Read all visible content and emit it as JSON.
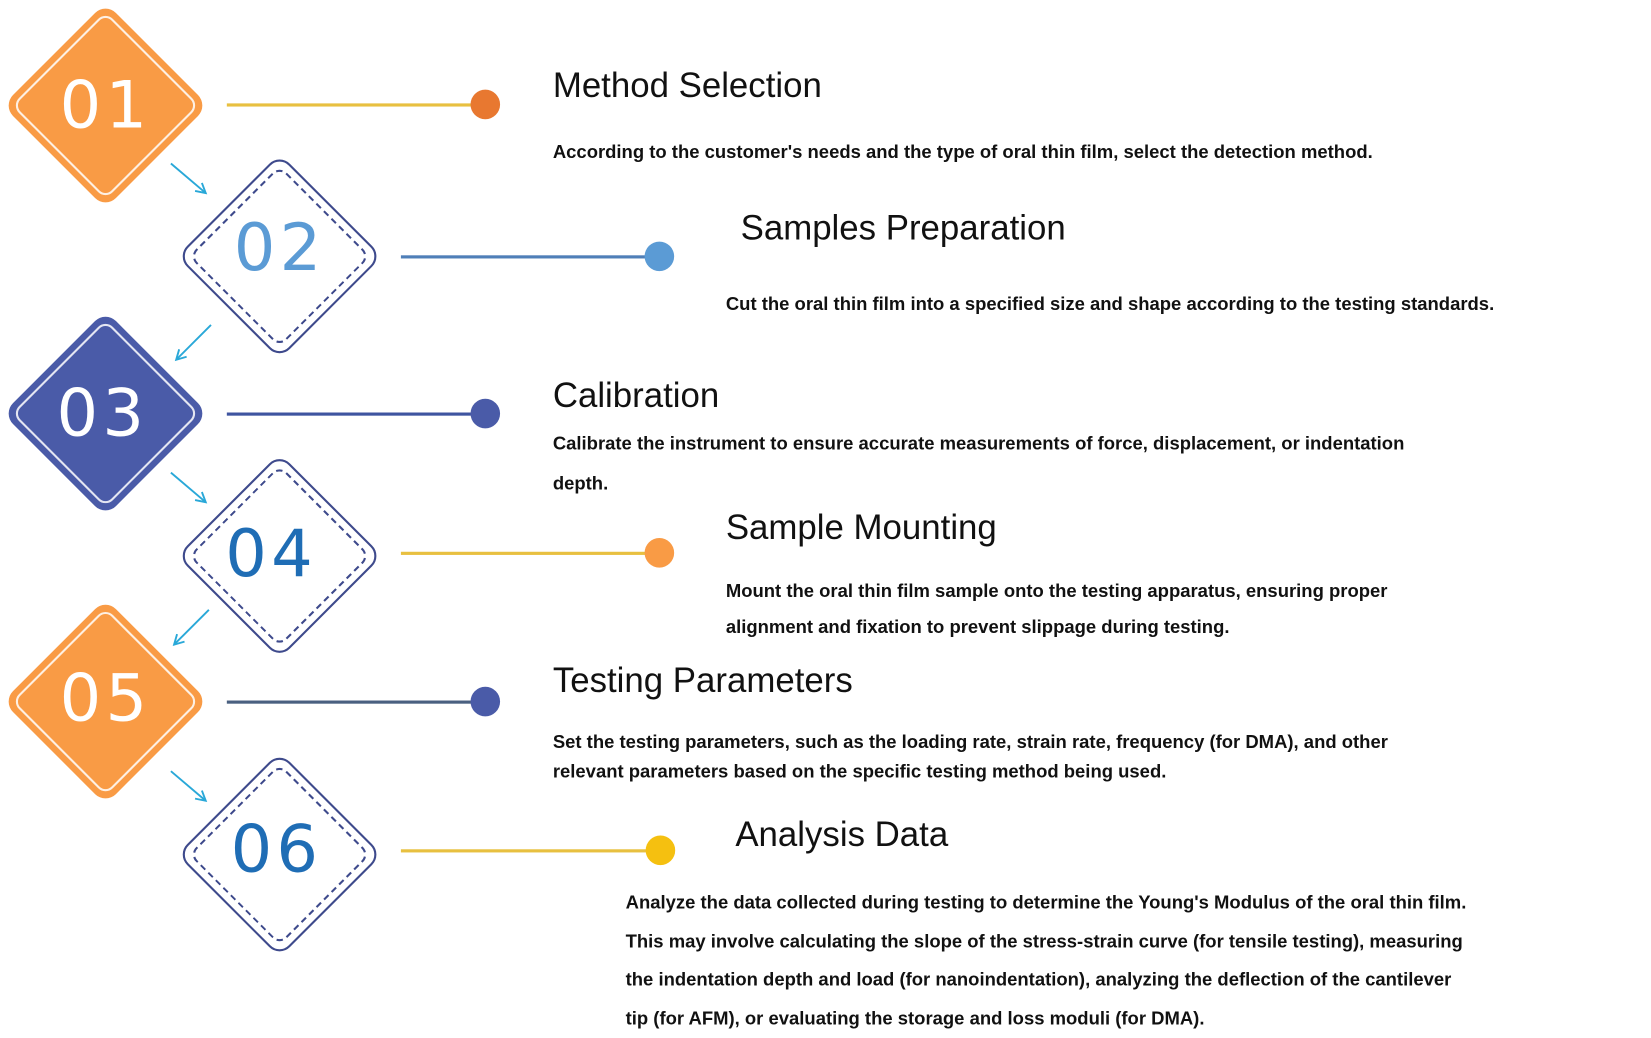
{
  "colors": {
    "orange": "#F99B45",
    "navy": "#4A5BA8",
    "outline": "#3E4A8C",
    "gold": "#E8C040",
    "arrow": "#29A8D8"
  },
  "steps": [
    {
      "number": "01",
      "title": "Method Selection",
      "lines": [
        "According to the customer's needs and the type of oral thin film, select the detection method."
      ]
    },
    {
      "number": "02",
      "title": "Samples Preparation",
      "lines": [
        "Cut the oral thin film into a specified size and shape according to the testing standards."
      ]
    },
    {
      "number": "03",
      "title": "Calibration",
      "lines": [
        "Calibrate the instrument to ensure accurate measurements of force, displacement, or indentation",
        "depth."
      ]
    },
    {
      "number": "04",
      "title": "Sample Mounting",
      "lines": [
        "Mount the oral thin film sample onto the testing apparatus, ensuring proper",
        "alignment and fixation to prevent slippage during testing."
      ]
    },
    {
      "number": "05",
      "title": "Testing Parameters",
      "lines": [
        "Set the testing parameters, such as the loading rate, strain rate, frequency (for DMA), and other",
        "relevant parameters based on the specific testing method being used."
      ]
    },
    {
      "number": "06",
      "title": "Analysis Data",
      "lines": [
        "Analyze the data collected during testing to determine the Young's Modulus of the oral thin film.",
        "This may involve calculating the slope of the stress-strain curve (for tensile testing), measuring",
        "the indentation depth and load (for nanoindentation), analyzing the deflection of the cantilever",
        "tip (for AFM), or evaluating the storage and loss moduli (for DMA)."
      ]
    }
  ]
}
